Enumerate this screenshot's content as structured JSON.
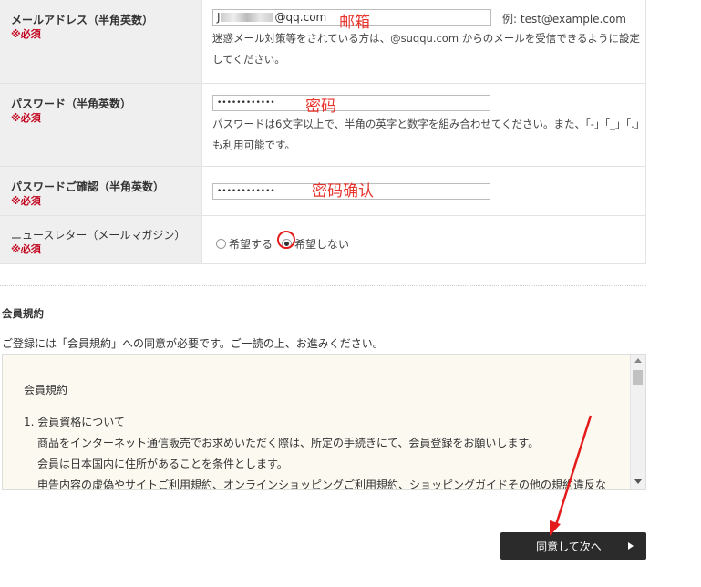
{
  "form": {
    "required_mark": "※必須",
    "email": {
      "label": "メールアドレス（半角英数）",
      "value_prefix": "J",
      "value_suffix": "@qq.com",
      "example": "例: test@example.com",
      "help": "迷惑メール対策等をされている方は、@suqqu.com からのメールを受信できるように設定してください。",
      "overlay": "邮箱"
    },
    "password": {
      "label": "パスワード（半角英数）",
      "value": "••••••••••••",
      "help": "パスワードは6文字以上で、半角の英字と数字を組み合わせてください。また、「-」「_」「.」も利用可能です。",
      "overlay": "密码"
    },
    "password_confirm": {
      "label": "パスワードご確認（半角英数）",
      "value": "••••••••••••",
      "overlay": "密码确认"
    },
    "newsletter": {
      "label": "ニュースレター（メールマガジン）",
      "options": [
        "希望する",
        "希望しない"
      ],
      "selected": "希望しない"
    }
  },
  "terms": {
    "section_title": "会員規約",
    "notice": "ご登録には「会員規約」への同意が必要です。ご一読の上、お進みください。",
    "box_title": "会員規約",
    "item1_title": "1. 会員資格について",
    "item1_lines": [
      "商品をインターネット通信販売でお求めいただく際は、所定の手続きにて、会員登録をお願いします。",
      "会員は日本国内に住所があることを条件とします。",
      "申告内容の虚偽やサイトご利用規約、オンラインショッピングご利用規約、ショッピングガイドその他の規約違反な"
    ]
  },
  "actions": {
    "agree_label": "同意して次へ"
  },
  "colors": {
    "annotation": "#e8352e",
    "required": "#c0001a",
    "button_bg": "#2b2b2b"
  }
}
